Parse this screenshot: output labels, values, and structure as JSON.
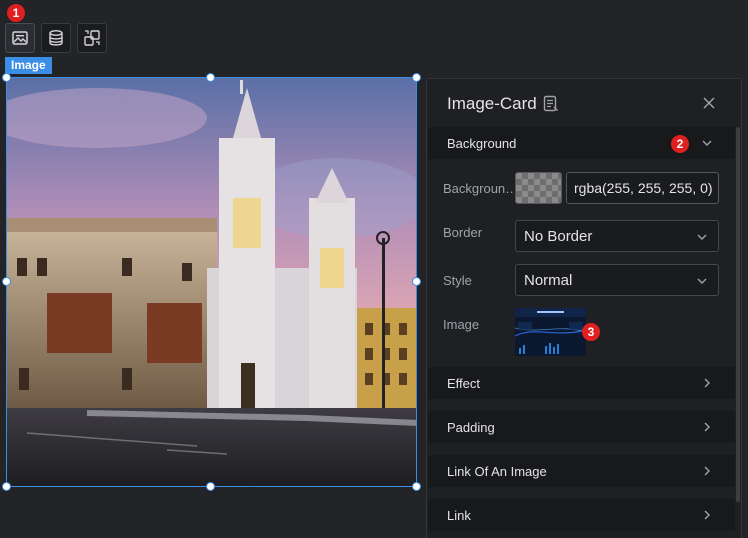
{
  "toolbar": {
    "buttons": [
      {
        "name": "image-icon"
      },
      {
        "name": "database-icon"
      },
      {
        "name": "transform-icon"
      }
    ]
  },
  "component_tag": "Image",
  "annotations": [
    "1",
    "2",
    "3"
  ],
  "panel": {
    "title": "Image-Card",
    "sections": {
      "background": "Background",
      "effect": "Effect",
      "padding": "Padding",
      "link_of_image": "Link Of An Image",
      "link": "Link"
    },
    "props": {
      "background_label": "Backgroun…",
      "background_value": "rgba(255, 255, 255, 0)",
      "border_label": "Border",
      "border_value": "No Border",
      "style_label": "Style",
      "style_value": "Normal",
      "image_label": "Image"
    }
  },
  "colors": {
    "accent": "#3a8ee6",
    "badge": "#e02020",
    "panel_bg": "#1f2023",
    "page_bg": "#232427"
  }
}
